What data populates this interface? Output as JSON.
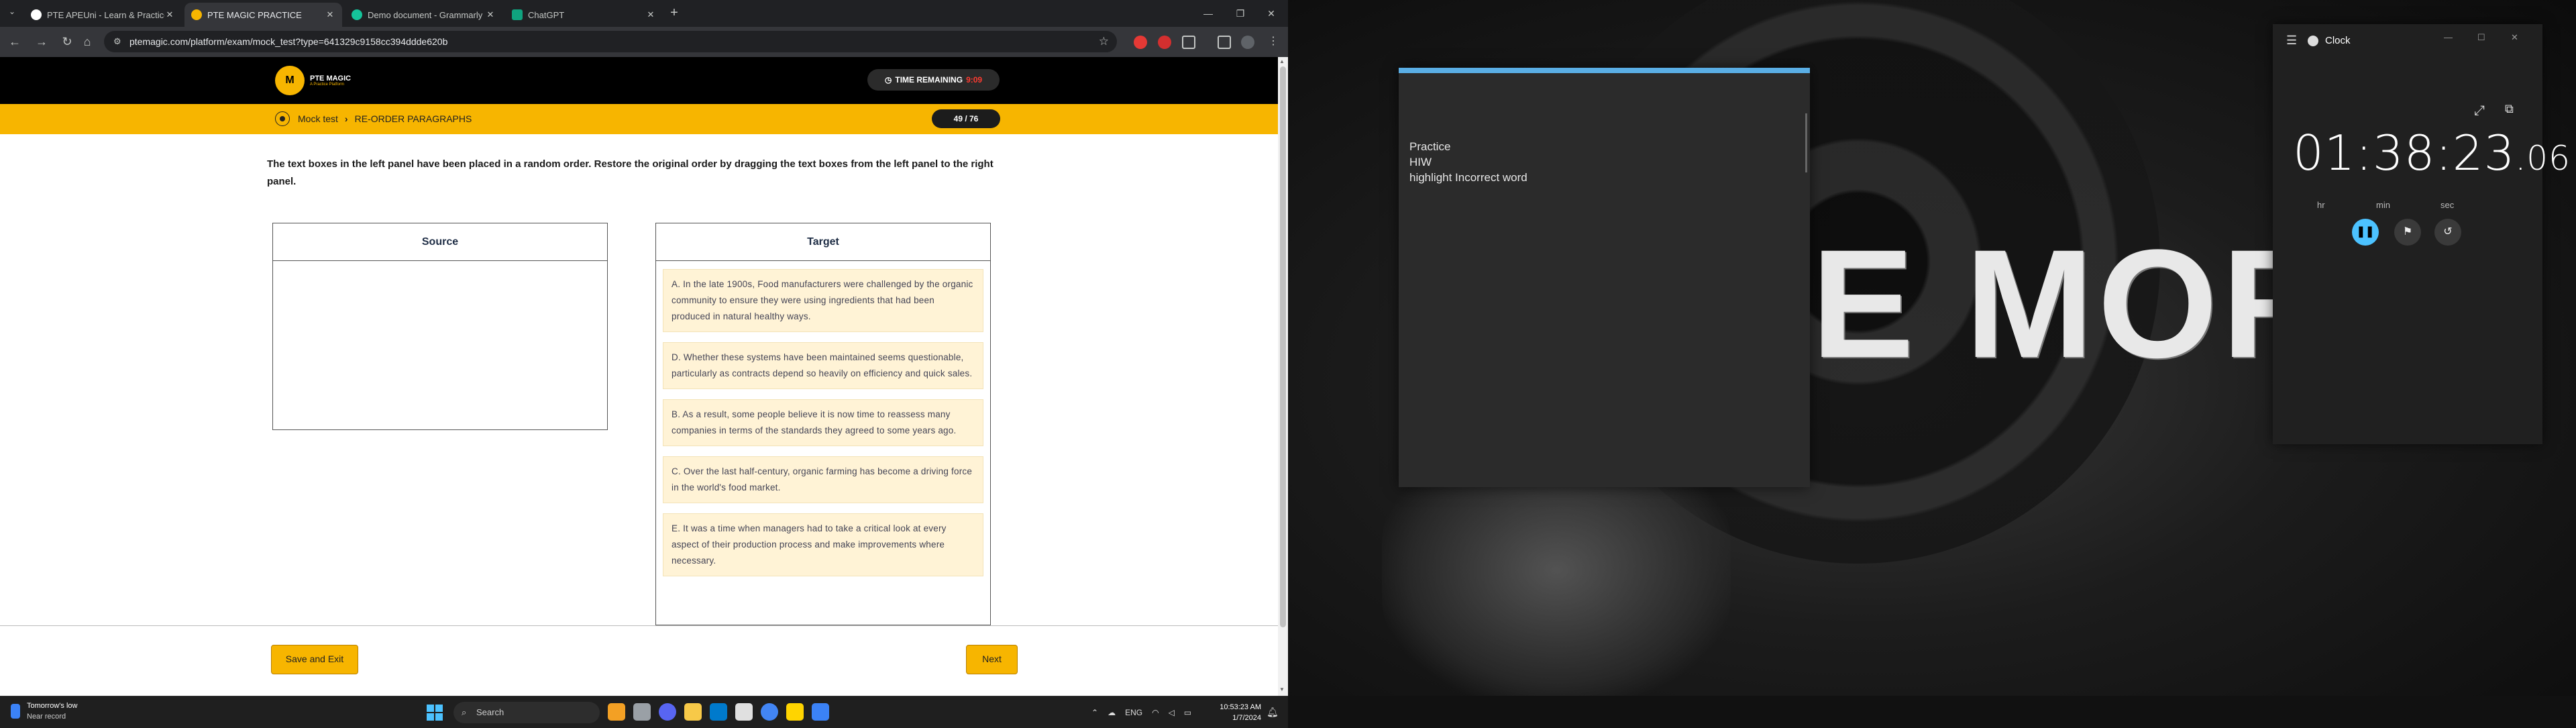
{
  "browser": {
    "tabs": [
      {
        "label": "PTE APEUni - Learn & Practice",
        "favicon_color": "#ffffff"
      },
      {
        "label": "PTE MAGIC PRACTICE",
        "favicon_color": "#f7b500"
      },
      {
        "label": "Demo document - Grammarly",
        "favicon_color": "#15c39a"
      },
      {
        "label": "ChatGPT",
        "favicon_color": "#10a37f"
      }
    ],
    "url": "ptemagic.com/platform/exam/mock_test?type=641329c9158cc394ddde620b",
    "window_controls": {
      "minimize": "—",
      "maximize": "❐",
      "close": "✕"
    }
  },
  "site": {
    "logo_badge": "M",
    "logo_name": "PTE MAGIC",
    "logo_tagline": "A Practice Platform",
    "timer_label": "TIME REMAINING",
    "timer_value": "9:09",
    "breadcrumb": [
      "Mock test",
      "RE-ORDER PARAGRAPHS"
    ],
    "progress": "49 / 76",
    "instructions": "The text boxes in the left panel have been placed in a random order. Restore the original order by dragging the text boxes from the left panel to the right panel.",
    "source_title": "Source",
    "target_title": "Target",
    "target_items": [
      "A. In the late 1900s, Food manufacturers were challenged by the organic community to ensure they were using ingredients that had been produced in natural healthy ways.",
      "D. Whether these systems have been maintained seems questionable, particularly as contracts depend so heavily on efficiency and quick sales.",
      "B. As a result, some people believe it is now time to reassess many companies in terms of the standards they agreed to some years ago.",
      "C. Over the last half-century, organic farming has become a driving force in the world's food market.",
      "E. It was a time when managers had to take a critical look at every aspect of their production process and make improvements where necessary."
    ],
    "save_exit_label": "Save and Exit",
    "next_label": "Next",
    "accent_color": "#f7b500"
  },
  "notes": {
    "lines": [
      "Practice",
      "HIW",
      "highlight Incorrect word"
    ]
  },
  "wallpaper": {
    "text": "E MORE"
  },
  "clock": {
    "title": "Clock",
    "hours": "01",
    "minutes": "38",
    "seconds": "23",
    "centiseconds": ".06",
    "unit_hr": "hr",
    "unit_min": "min",
    "unit_sec": "sec"
  },
  "taskbar": {
    "weather_line1": "Tomorrow's low",
    "weather_line2": "Near record",
    "search_placeholder": "Search",
    "language": "ENG",
    "time": "10:53:23 AM",
    "date": "1/7/2024"
  }
}
